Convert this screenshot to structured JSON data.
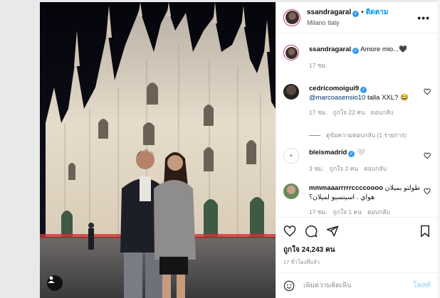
{
  "post": {
    "username": "ssandragaral",
    "follow_label": "ติดตาม",
    "location": "Milano Italy",
    "more_label": "•••"
  },
  "comments": [
    {
      "username": "ssandragaral",
      "text": "Amore mio...",
      "emoji": "🖤",
      "age": "17 ชม.",
      "likes": "",
      "reply": ""
    },
    {
      "username": "cedricomoigui9",
      "mention": "@marcoasensio10",
      "text": " talla XXL? ",
      "emoji": "😂",
      "age": "17 ชม.",
      "likes": "ถูกใจ 22 คน",
      "reply": "ตอบกลับ"
    },
    {
      "username": "bleismadrid",
      "text": "",
      "emoji": "🤍",
      "age": "3 ชม.",
      "likes": "ถูกใจ 2 คน",
      "reply": "ตอบกลับ"
    },
    {
      "username": "mmmaaarrrrrccccoooo",
      "text": "طولتو بميلان",
      "text2": "هواي . اسينسيو لميلان؟",
      "age": "17 ชม.",
      "likes": "ถูกใจ 1 คน",
      "reply": "ตอบกลับ"
    }
  ],
  "view_replies": "ดูข้อความตอบกลับ (1 รายการ)",
  "likes_total": "ถูกใจ 24,243 คน",
  "posted_ago": "17 ชั่วโมงที่แล้ว",
  "comment_box": {
    "placeholder": "เพิ่มความคิดเห็น",
    "post_label": "โพสต์"
  },
  "colors": {
    "accent": "#0095f6",
    "verified": "#3897f0",
    "post_disabled": "#b2dffc"
  },
  "icons": [
    "user-tag-icon",
    "heart-icon",
    "comment-icon",
    "share-icon",
    "bookmark-icon",
    "emoji-icon",
    "more-icon"
  ]
}
